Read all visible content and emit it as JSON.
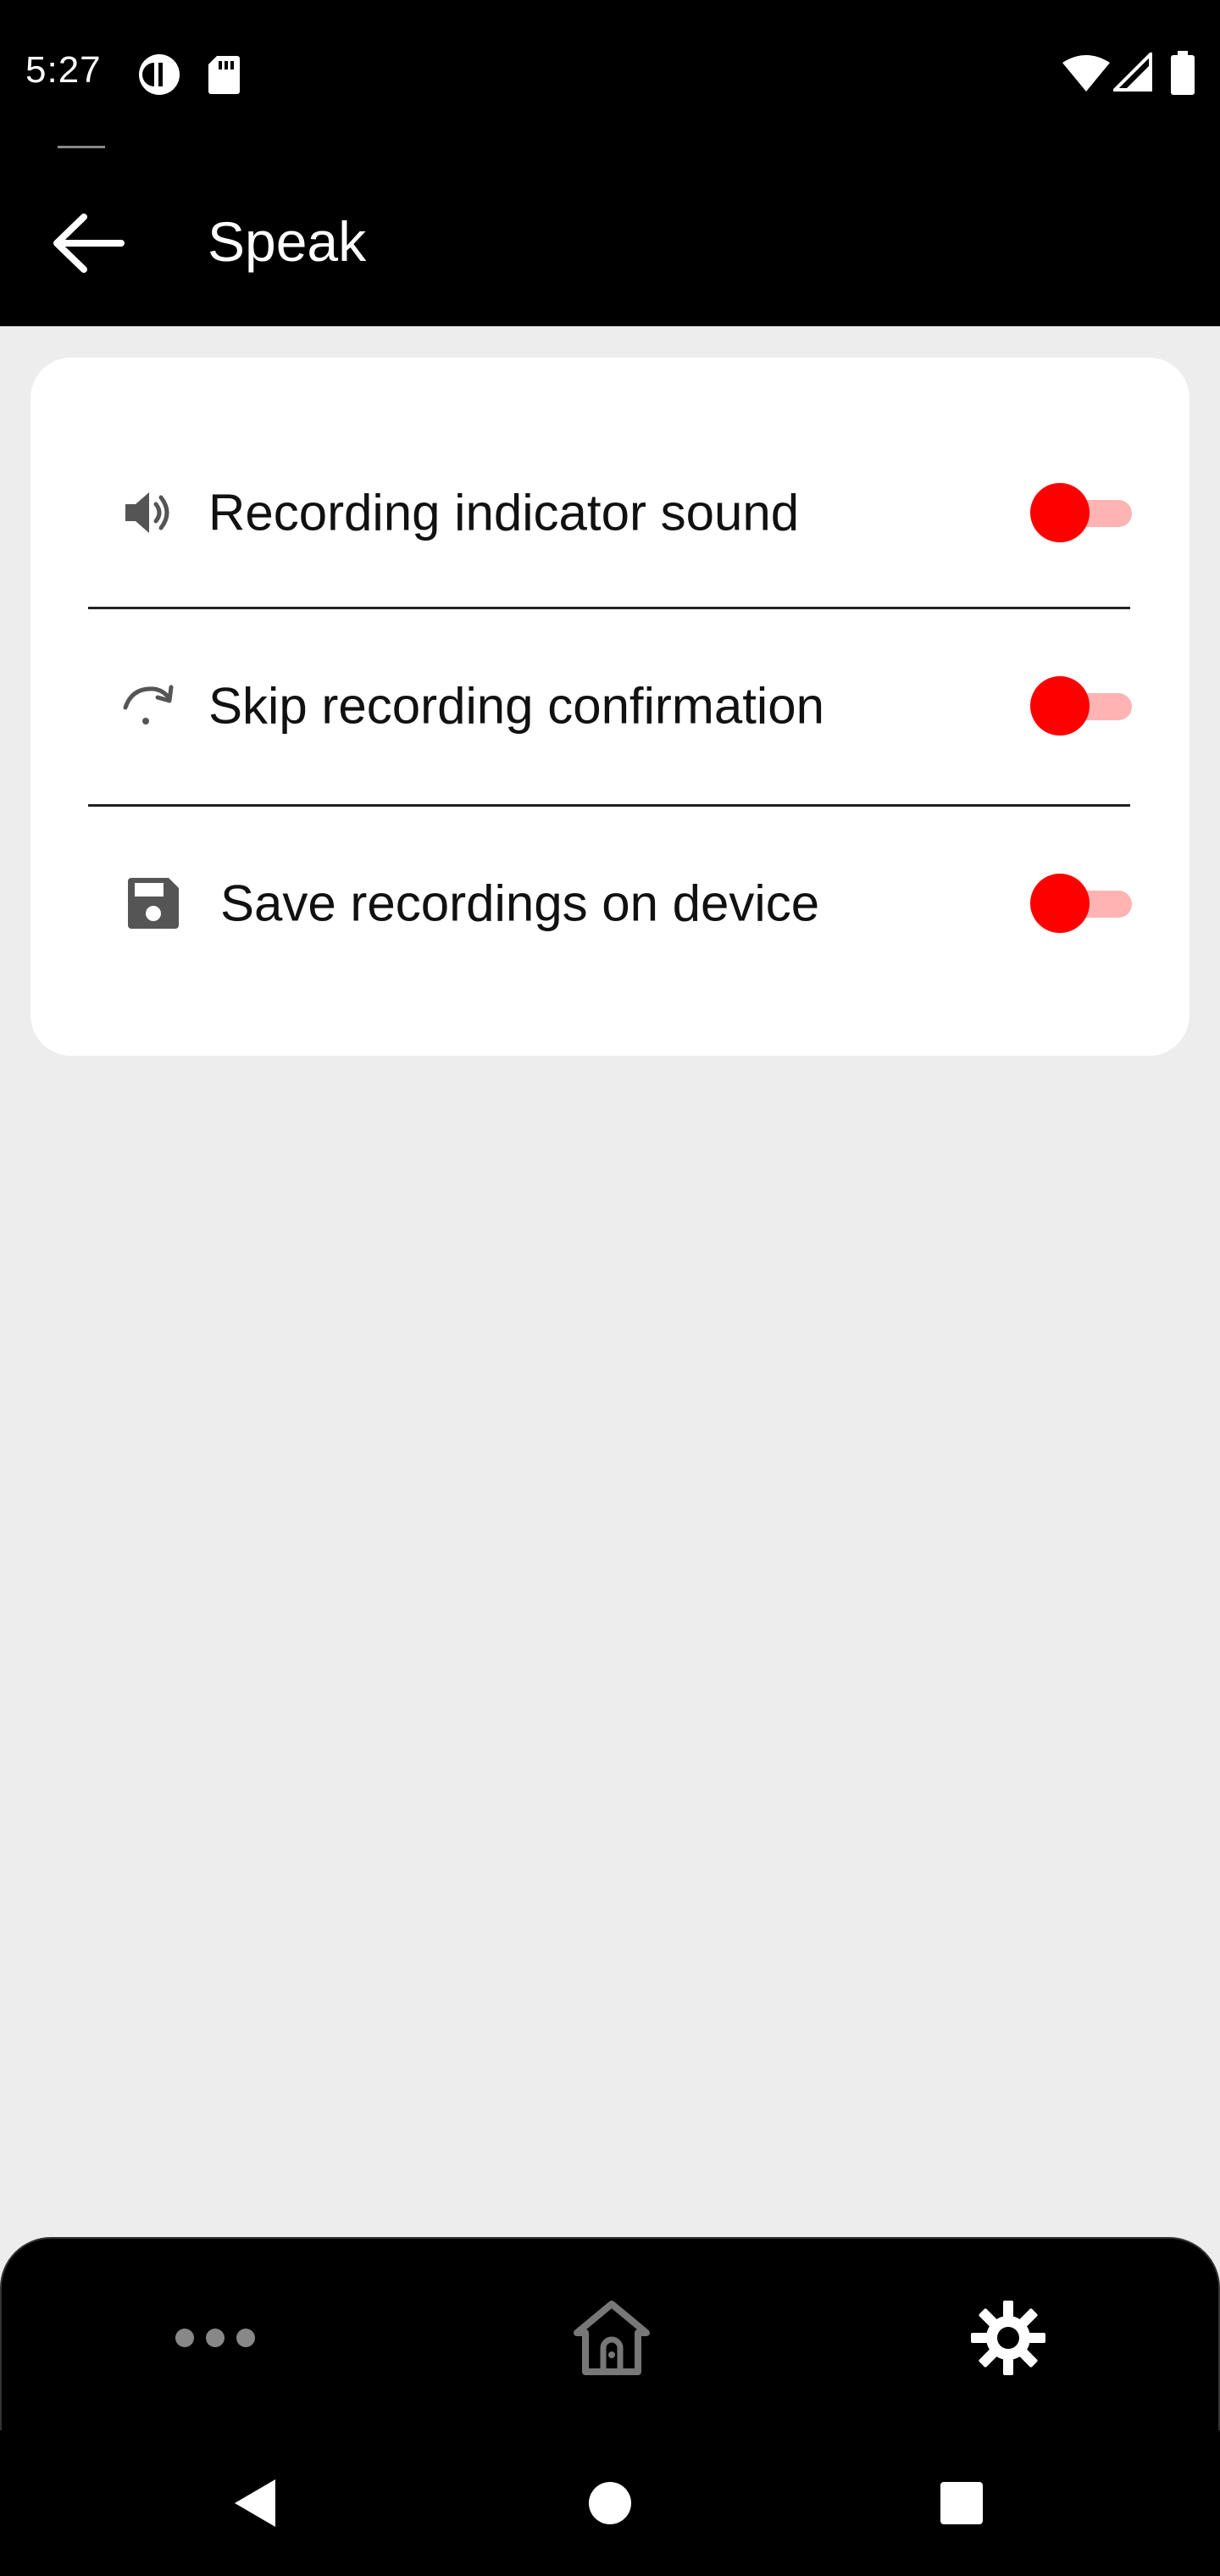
{
  "status_bar": {
    "time": "5:27",
    "icons": [
      "data-saver-icon",
      "sd-card-icon",
      "wifi-icon",
      "cell-signal-icon",
      "battery-icon"
    ]
  },
  "app_bar": {
    "title": "Speak",
    "back_icon": "arrow-left-icon"
  },
  "settings": {
    "items": [
      {
        "label": "Recording indicator sound",
        "icon": "speaker-icon",
        "enabled": true
      },
      {
        "label": "Skip recording confirmation",
        "icon": "skip-arrow-icon",
        "enabled": true
      },
      {
        "label": "Save recordings on device",
        "icon": "save-icon",
        "enabled": true
      }
    ]
  },
  "bottom_nav": {
    "items": [
      {
        "icon": "more-dots-icon",
        "active": false
      },
      {
        "icon": "home-icon",
        "active": false
      },
      {
        "icon": "gear-icon",
        "active": true
      }
    ]
  },
  "system_nav": {
    "icons": [
      "back-triangle-icon",
      "home-circle-icon",
      "recents-square-icon"
    ]
  },
  "colors": {
    "toggle_thumb": "#ff0000",
    "toggle_track": "#ffb3b3",
    "background": "#ededed",
    "bars": "#000000"
  }
}
